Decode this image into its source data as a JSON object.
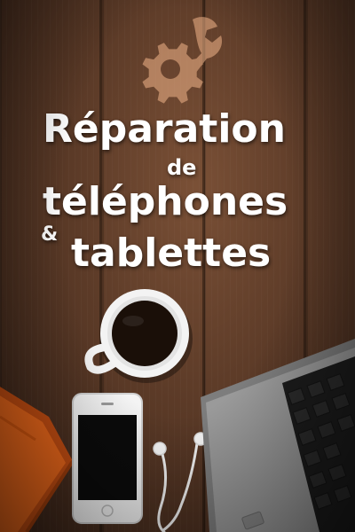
{
  "title": {
    "line1": "Réparation",
    "line2": "de",
    "line3": "téléphones",
    "ampersand": "&",
    "line4": "tablettes"
  },
  "colors": {
    "wood": "#5b3a27",
    "text": "#ffffff",
    "logo": "#f2b58a",
    "notebook": "#f26a1b",
    "laptop": "#8a8a8a",
    "phone": "#f4f4f4",
    "coffee": "#1a0f08"
  },
  "icons": [
    "gear-wrench-icon"
  ]
}
